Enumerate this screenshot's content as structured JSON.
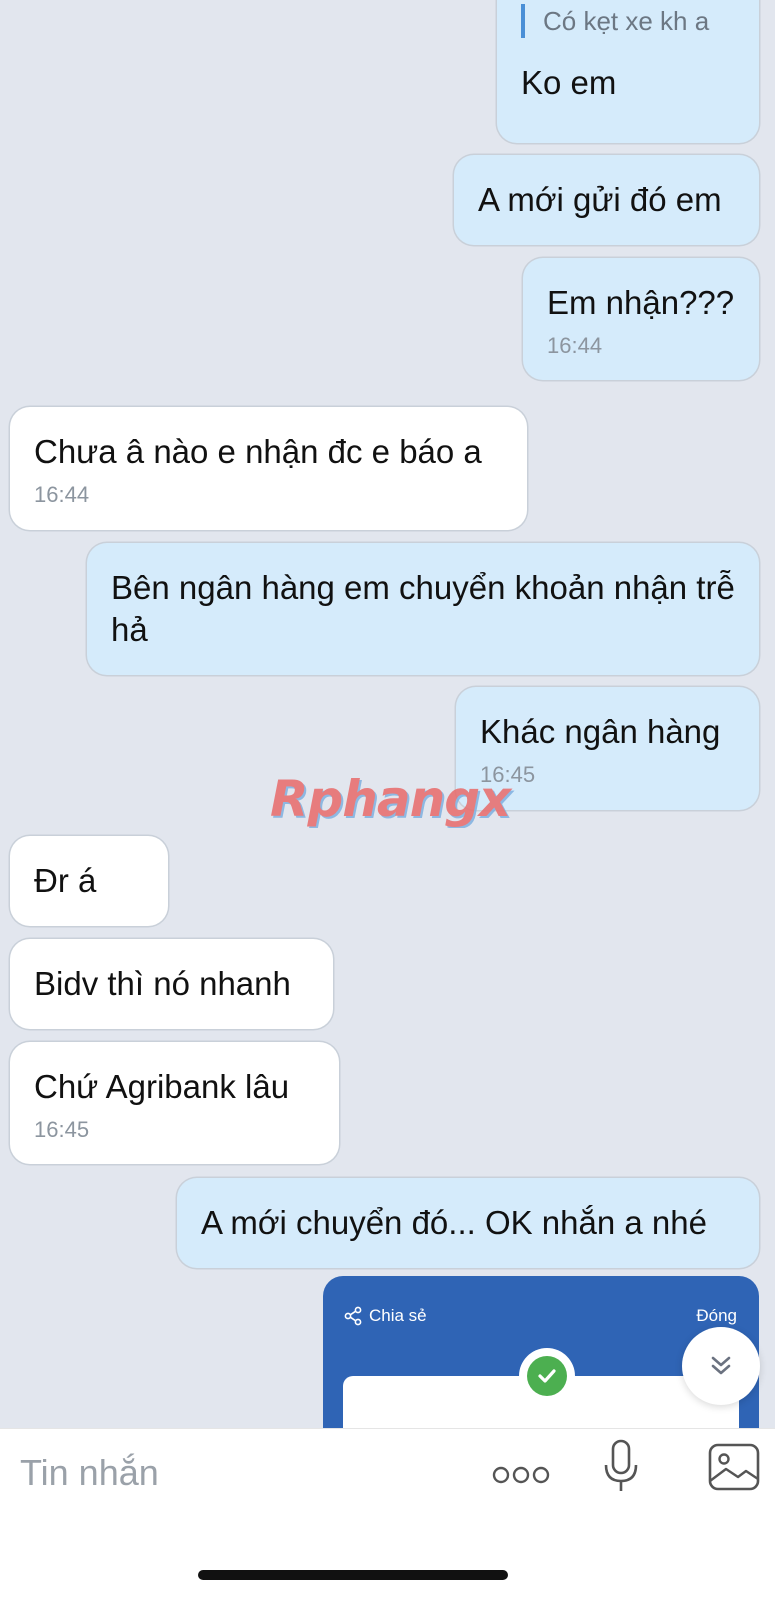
{
  "messages": [
    {
      "id": "m1",
      "dir": "out",
      "quote": "Có kẹt xe kh a",
      "text": "Ko em",
      "time": ""
    },
    {
      "id": "m2",
      "dir": "out",
      "text": "A mới gửi đó em",
      "time": ""
    },
    {
      "id": "m3",
      "dir": "out",
      "text": "Em nhận???",
      "time": "16:44"
    },
    {
      "id": "m4",
      "dir": "in",
      "text": "Chưa â nào e nhận đc e báo a",
      "time": "16:44"
    },
    {
      "id": "m5",
      "dir": "out",
      "text": "Bên ngân hàng em chuyển khoản nhận trễ hả",
      "time": ""
    },
    {
      "id": "m6",
      "dir": "out",
      "text": "Khác ngân hàng",
      "time": "16:45"
    },
    {
      "id": "m7",
      "dir": "in",
      "text": "Đr á",
      "time": ""
    },
    {
      "id": "m8",
      "dir": "in",
      "text": "Bidv thì nó nhanh",
      "time": ""
    },
    {
      "id": "m9",
      "dir": "in",
      "text": "Chứ Agribank lâu",
      "time": "16:45"
    },
    {
      "id": "m10",
      "dir": "out",
      "text": "A mới chuyển đó... OK nhắn a nhé",
      "time": ""
    }
  ],
  "watermark": "Rphangx",
  "receipt_preview": {
    "share_label": "Chia sẻ",
    "close_label": "Đóng"
  },
  "input": {
    "placeholder": "Tin nhắn"
  },
  "icons": {
    "more": "more-dots-icon",
    "mic": "microphone-icon",
    "image": "image-icon",
    "scroll": "chevron-double-down-icon",
    "check": "check-circle-icon",
    "share": "share-icon"
  },
  "colors": {
    "background": "#e2e6ee",
    "outgoing_bubble": "#d5ebfb",
    "incoming_bubble": "#ffffff",
    "receipt_header": "#2f64b5",
    "success": "#4caf50"
  }
}
